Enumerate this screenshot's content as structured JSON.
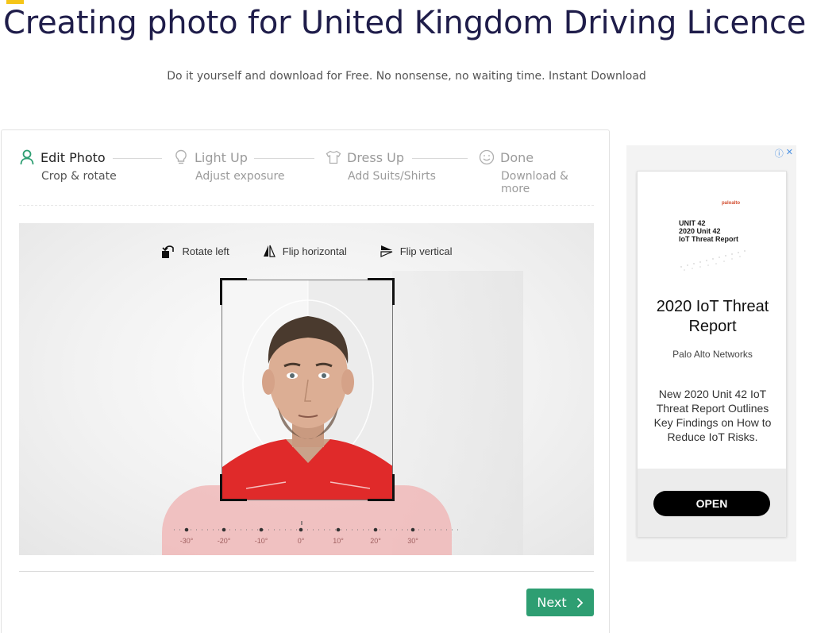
{
  "header": {
    "title": "Creating photo for United Kingdom Driving Licence",
    "subtitle": "Do it yourself and download for Free. No nonsense, no waiting time. Instant Download"
  },
  "steps": [
    {
      "label": "Edit Photo",
      "sub": "Crop & rotate",
      "icon": "user-icon",
      "active": true
    },
    {
      "label": "Light Up",
      "sub": "Adjust exposure",
      "icon": "lightbulb-icon",
      "active": false
    },
    {
      "label": "Dress Up",
      "sub": "Add Suits/Shirts",
      "icon": "shirt-icon",
      "active": false
    },
    {
      "label": "Done",
      "sub": "Download & more",
      "icon": "smile-icon",
      "active": false
    }
  ],
  "tools": {
    "rotate_left": "Rotate left",
    "flip_horizontal": "Flip horizontal",
    "flip_vertical": "Flip vertical"
  },
  "ruler": {
    "labels": [
      "-30°",
      "-20°",
      "-10°",
      "0°",
      "10°",
      "20°",
      "30°"
    ],
    "current": "0°"
  },
  "footer": {
    "next_label": "Next"
  },
  "ad": {
    "logo": "paloalto",
    "unit_line1": "UNIT 42",
    "unit_line2": "2020 Unit 42",
    "unit_line3": "IoT Threat Report",
    "heading": "2020 IoT Threat Report",
    "brand": "Palo Alto Networks",
    "body": "New 2020 Unit 42 IoT Threat Report Outlines Key Findings on How to Reduce IoT Risks.",
    "cta": "OPEN"
  },
  "colors": {
    "title": "#1f1d4a",
    "accent": "#f5c518",
    "active_step": "#2e9e72",
    "next_button": "#2e9e72"
  }
}
